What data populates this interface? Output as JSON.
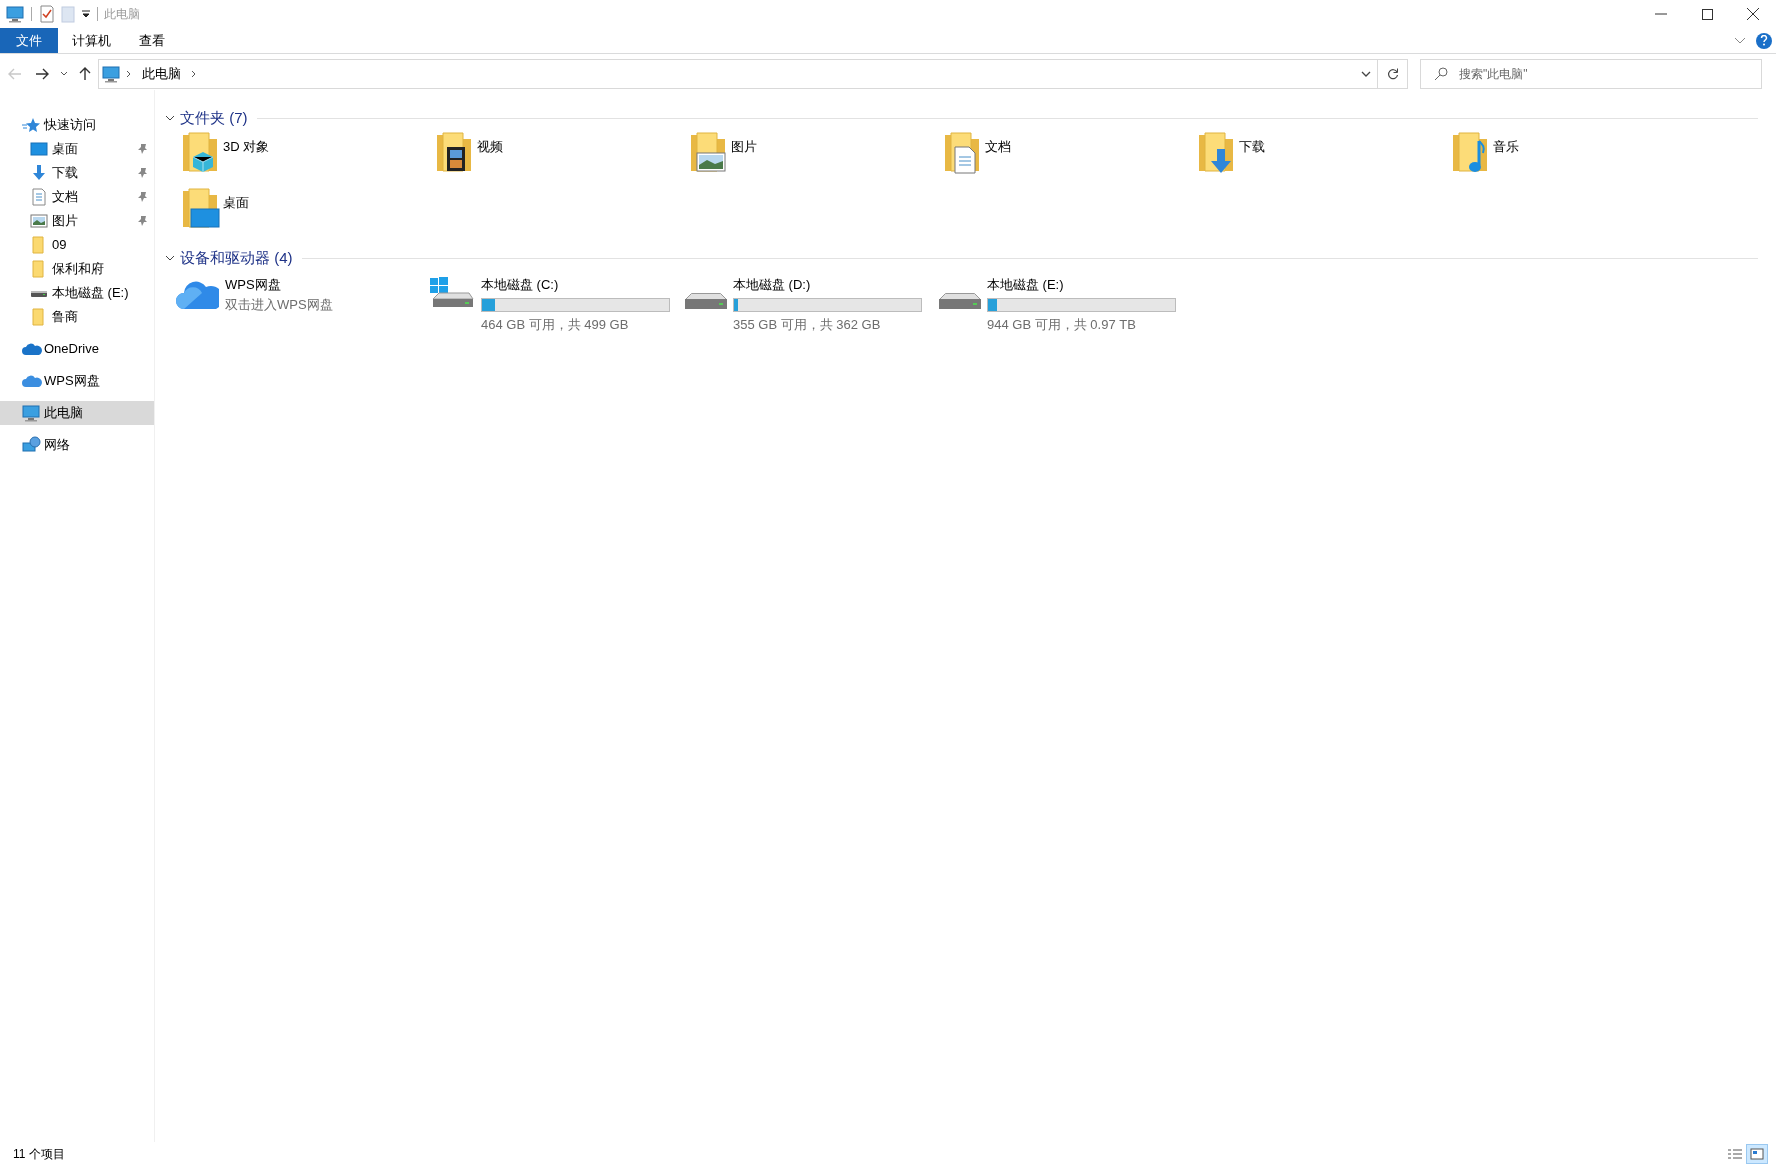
{
  "window": {
    "title": "此电脑"
  },
  "ribbon_tabs": [
    {
      "label": "文件",
      "kind": "file"
    },
    {
      "label": "计算机",
      "kind": "tab"
    },
    {
      "label": "查看",
      "kind": "tab"
    }
  ],
  "navigation": {
    "back_disabled": true
  },
  "address_bar": {
    "path": "此电脑"
  },
  "search": {
    "placeholder": "搜索\"此电脑\""
  },
  "sidebar": {
    "items": [
      {
        "label": "快速访问",
        "kind": "star",
        "selected": false,
        "children": [
          {
            "label": "桌面",
            "kind": "desktop",
            "pinned": true,
            "selected": false
          },
          {
            "label": "下载",
            "kind": "download",
            "pinned": true,
            "selected": false
          },
          {
            "label": "文档",
            "kind": "document",
            "pinned": true,
            "selected": false
          },
          {
            "label": "图片",
            "kind": "picture",
            "pinned": true,
            "selected": false
          },
          {
            "label": "09",
            "kind": "folder",
            "pinned": false,
            "selected": false
          },
          {
            "label": "保利和府",
            "kind": "folder",
            "pinned": false,
            "selected": false
          },
          {
            "label": "本地磁盘 (E:)",
            "kind": "drive",
            "pinned": false,
            "selected": false
          },
          {
            "label": "鲁商",
            "kind": "folder",
            "pinned": false,
            "selected": false
          }
        ]
      },
      {
        "label": "OneDrive",
        "kind": "cloud",
        "selected": false
      },
      {
        "label": "WPS网盘",
        "kind": "wps",
        "selected": false
      },
      {
        "label": "此电脑",
        "kind": "pc",
        "selected": true
      },
      {
        "label": "网络",
        "kind": "network",
        "selected": false
      }
    ]
  },
  "folders": {
    "title": "文件夹 (7)",
    "items": [
      {
        "label": "3D 对象",
        "kind": "objects"
      },
      {
        "label": "视频",
        "kind": "video"
      },
      {
        "label": "图片",
        "kind": "picture"
      },
      {
        "label": "文档",
        "kind": "document"
      },
      {
        "label": "下载",
        "kind": "download"
      },
      {
        "label": "音乐",
        "kind": "music"
      },
      {
        "label": "桌面",
        "kind": "desktop"
      }
    ]
  },
  "devices": {
    "title": "设备和驱动器 (4)",
    "items": [
      {
        "kind": "cloud",
        "label": "WPS网盘",
        "subtitle": "双击进入WPS网盘"
      },
      {
        "kind": "system_drive",
        "label": "本地磁盘 (C:)",
        "level": 0.07,
        "reading": "464 GB 可用，共 499 GB"
      },
      {
        "kind": "drive",
        "label": "本地磁盘 (D:)",
        "level": 0.02,
        "reading": "355 GB 可用，共 362 GB"
      },
      {
        "kind": "drive",
        "label": "本地磁盘 (E:)",
        "level": 0.05,
        "reading": "944 GB 可用，共 0.97 TB"
      }
    ]
  },
  "status_bar": {
    "text": "11 个项目"
  }
}
